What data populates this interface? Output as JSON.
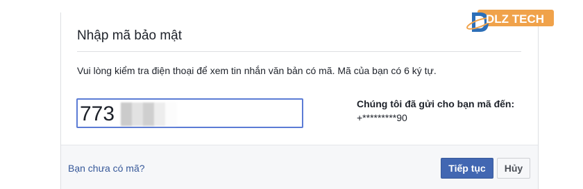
{
  "dialog": {
    "title": "Nhập mã bảo mật",
    "instruction": "Vui lòng kiểm tra điện thoại để xem tin nhắn văn bản có mã. Mã của bạn có 6 ký tự.",
    "code_value": "773",
    "sent_label": "Chúng tôi đã gửi cho bạn mã đến:",
    "sent_phone": "+*********90"
  },
  "footer": {
    "no_code_link": "Bạn chưa có mã?",
    "continue_label": "Tiếp tục",
    "cancel_label": "Hủy"
  },
  "watermark": {
    "brand": "DLZ TECH",
    "colors": {
      "orange": "#f0a24a",
      "blue": "#2d6fb8"
    }
  },
  "colors": {
    "primary_button": "#4267b2",
    "link": "#365899",
    "input_border": "#5b7bd5"
  }
}
